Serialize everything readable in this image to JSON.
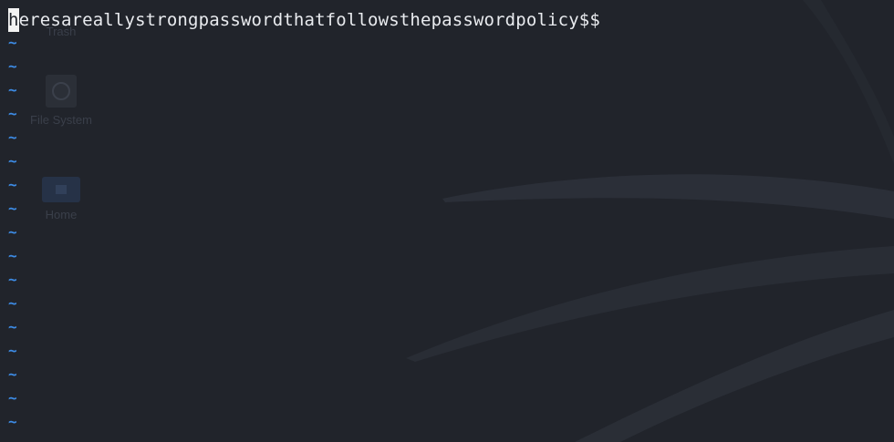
{
  "desktop": {
    "icons": [
      {
        "label": "Trash",
        "icon": "trash-icon"
      },
      {
        "label": "File System",
        "icon": "drive-icon"
      },
      {
        "label": "Home",
        "icon": "home-folder-icon"
      }
    ]
  },
  "editor": {
    "cursor_char": "h",
    "line_rest": "eresareallystrongpasswordthatfollowsthepasswordpolicy$$",
    "empty_line_marker": "~",
    "empty_line_count": 17
  },
  "colors": {
    "background": "#21242b",
    "text": "#e9ebef",
    "tilde": "#3d8ce6",
    "cursor": "#f2f2f2"
  }
}
